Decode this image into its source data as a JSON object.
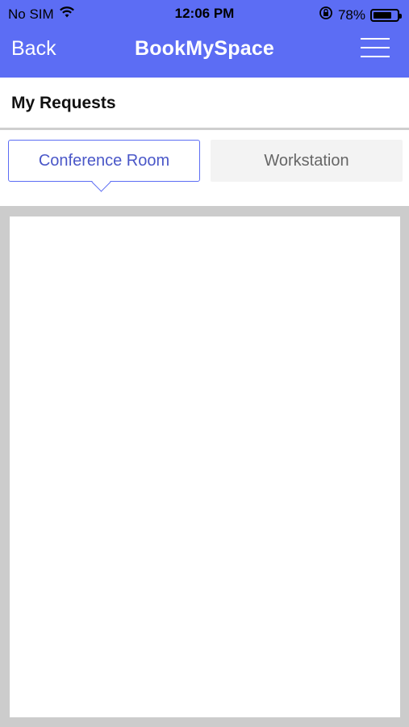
{
  "status_bar": {
    "carrier": "No SIM",
    "time": "12:06 PM",
    "battery_percent": "78%",
    "battery_level": 0.78,
    "icons": [
      "wifi-icon",
      "orientation-lock-icon",
      "battery-icon"
    ]
  },
  "header": {
    "back_label": "Back",
    "app_title": "BookMySpace",
    "menu_icon": "hamburger-menu-icon",
    "background_color": "#5c6df4"
  },
  "page": {
    "title": "My Requests"
  },
  "tabs": [
    {
      "label": "Conference Room",
      "selected": true
    },
    {
      "label": "Workstation",
      "selected": false
    }
  ],
  "colors": {
    "accent": "#5c6df4",
    "content_background": "#cccccc"
  }
}
